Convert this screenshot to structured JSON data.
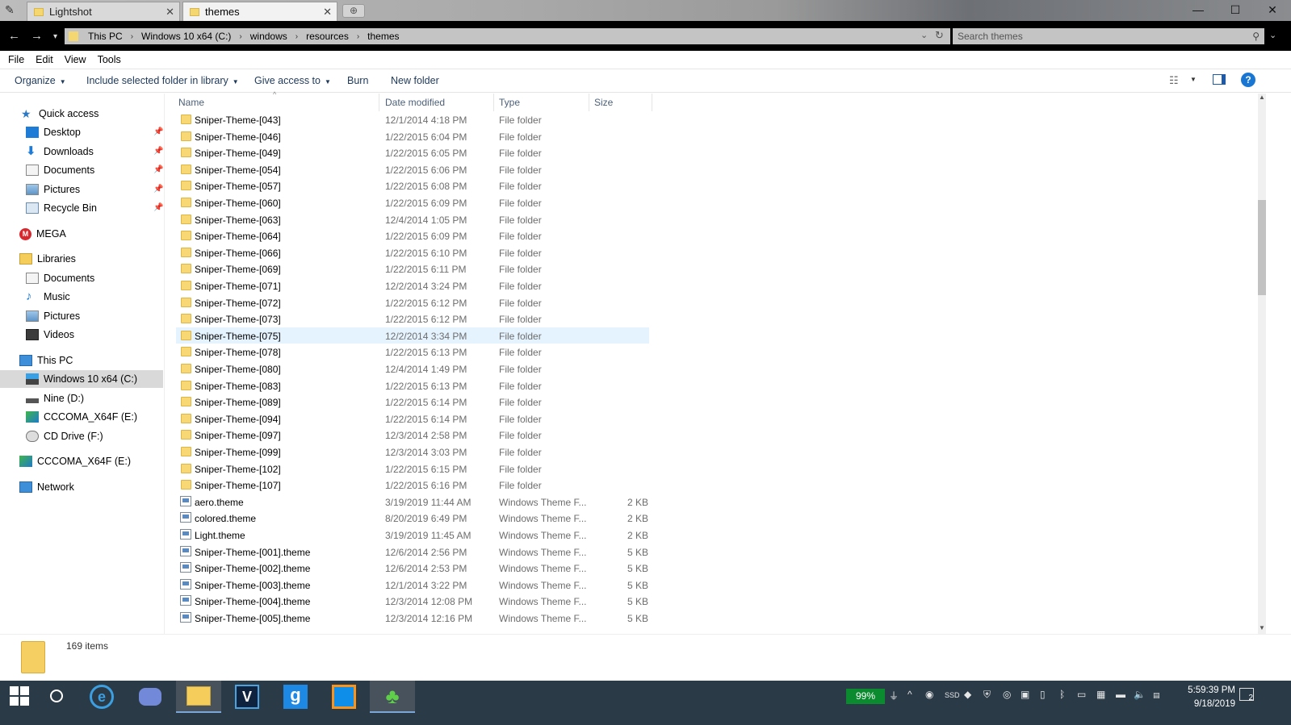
{
  "tabs": [
    {
      "label": "Lightshot"
    },
    {
      "label": "themes"
    }
  ],
  "window_controls": {
    "minimize": "—",
    "maximize": "☐",
    "close": "✕"
  },
  "address": {
    "segments": [
      "This PC",
      "Windows 10 x64 (C:)",
      "windows",
      "resources",
      "themes"
    ],
    "search_placeholder": "Search themes"
  },
  "menu": [
    "File",
    "Edit",
    "View",
    "Tools"
  ],
  "commands": {
    "organize": "Organize",
    "include": "Include selected folder in library",
    "give_access": "Give access to",
    "burn": "Burn",
    "new_folder": "New folder"
  },
  "nav": {
    "quick_access": "Quick access",
    "desktop": "Desktop",
    "downloads": "Downloads",
    "documents": "Documents",
    "pictures": "Pictures",
    "recycle_bin": "Recycle Bin",
    "mega": "MEGA",
    "libraries": "Libraries",
    "lib_documents": "Documents",
    "lib_music": "Music",
    "lib_pictures": "Pictures",
    "lib_videos": "Videos",
    "this_pc": "This PC",
    "drive_c": "Windows 10 x64 (C:)",
    "drive_d": "Nine (D:)",
    "drive_e": "CCCOMA_X64F (E:)",
    "drive_f": "CD Drive (F:)",
    "drive_e2": "CCCOMA_X64F (E:)",
    "network": "Network"
  },
  "columns": {
    "name": "Name",
    "date": "Date modified",
    "type": "Type",
    "size": "Size"
  },
  "files": [
    {
      "name": "Sniper-Theme-[043]",
      "date": "12/1/2014 4:18 PM",
      "type": "File folder",
      "size": "",
      "kind": "folder"
    },
    {
      "name": "Sniper-Theme-[046]",
      "date": "1/22/2015 6:04 PM",
      "type": "File folder",
      "size": "",
      "kind": "folder"
    },
    {
      "name": "Sniper-Theme-[049]",
      "date": "1/22/2015 6:05 PM",
      "type": "File folder",
      "size": "",
      "kind": "folder"
    },
    {
      "name": "Sniper-Theme-[054]",
      "date": "1/22/2015 6:06 PM",
      "type": "File folder",
      "size": "",
      "kind": "folder"
    },
    {
      "name": "Sniper-Theme-[057]",
      "date": "1/22/2015 6:08 PM",
      "type": "File folder",
      "size": "",
      "kind": "folder"
    },
    {
      "name": "Sniper-Theme-[060]",
      "date": "1/22/2015 6:09 PM",
      "type": "File folder",
      "size": "",
      "kind": "folder"
    },
    {
      "name": "Sniper-Theme-[063]",
      "date": "12/4/2014 1:05 PM",
      "type": "File folder",
      "size": "",
      "kind": "folder"
    },
    {
      "name": "Sniper-Theme-[064]",
      "date": "1/22/2015 6:09 PM",
      "type": "File folder",
      "size": "",
      "kind": "folder"
    },
    {
      "name": "Sniper-Theme-[066]",
      "date": "1/22/2015 6:10 PM",
      "type": "File folder",
      "size": "",
      "kind": "folder"
    },
    {
      "name": "Sniper-Theme-[069]",
      "date": "1/22/2015 6:11 PM",
      "type": "File folder",
      "size": "",
      "kind": "folder"
    },
    {
      "name": "Sniper-Theme-[071]",
      "date": "12/2/2014 3:24 PM",
      "type": "File folder",
      "size": "",
      "kind": "folder"
    },
    {
      "name": "Sniper-Theme-[072]",
      "date": "1/22/2015 6:12 PM",
      "type": "File folder",
      "size": "",
      "kind": "folder"
    },
    {
      "name": "Sniper-Theme-[073]",
      "date": "1/22/2015 6:12 PM",
      "type": "File folder",
      "size": "",
      "kind": "folder"
    },
    {
      "name": "Sniper-Theme-[075]",
      "date": "12/2/2014 3:34 PM",
      "type": "File folder",
      "size": "",
      "kind": "folder",
      "selected": true
    },
    {
      "name": "Sniper-Theme-[078]",
      "date": "1/22/2015 6:13 PM",
      "type": "File folder",
      "size": "",
      "kind": "folder"
    },
    {
      "name": "Sniper-Theme-[080]",
      "date": "12/4/2014 1:49 PM",
      "type": "File folder",
      "size": "",
      "kind": "folder"
    },
    {
      "name": "Sniper-Theme-[083]",
      "date": "1/22/2015 6:13 PM",
      "type": "File folder",
      "size": "",
      "kind": "folder"
    },
    {
      "name": "Sniper-Theme-[089]",
      "date": "1/22/2015 6:14 PM",
      "type": "File folder",
      "size": "",
      "kind": "folder"
    },
    {
      "name": "Sniper-Theme-[094]",
      "date": "1/22/2015 6:14 PM",
      "type": "File folder",
      "size": "",
      "kind": "folder"
    },
    {
      "name": "Sniper-Theme-[097]",
      "date": "12/3/2014 2:58 PM",
      "type": "File folder",
      "size": "",
      "kind": "folder"
    },
    {
      "name": "Sniper-Theme-[099]",
      "date": "12/3/2014 3:03 PM",
      "type": "File folder",
      "size": "",
      "kind": "folder"
    },
    {
      "name": "Sniper-Theme-[102]",
      "date": "1/22/2015 6:15 PM",
      "type": "File folder",
      "size": "",
      "kind": "folder"
    },
    {
      "name": "Sniper-Theme-[107]",
      "date": "1/22/2015 6:16 PM",
      "type": "File folder",
      "size": "",
      "kind": "folder"
    },
    {
      "name": "aero.theme",
      "date": "3/19/2019 11:44 AM",
      "type": "Windows Theme F...",
      "size": "2 KB",
      "kind": "theme"
    },
    {
      "name": "colored.theme",
      "date": "8/20/2019 6:49 PM",
      "type": "Windows Theme F...",
      "size": "2 KB",
      "kind": "theme"
    },
    {
      "name": "Light.theme",
      "date": "3/19/2019 11:45 AM",
      "type": "Windows Theme F...",
      "size": "2 KB",
      "kind": "theme"
    },
    {
      "name": "Sniper-Theme-[001].theme",
      "date": "12/6/2014 2:56 PM",
      "type": "Windows Theme F...",
      "size": "5 KB",
      "kind": "theme"
    },
    {
      "name": "Sniper-Theme-[002].theme",
      "date": "12/6/2014 2:53 PM",
      "type": "Windows Theme F...",
      "size": "5 KB",
      "kind": "theme"
    },
    {
      "name": "Sniper-Theme-[003].theme",
      "date": "12/1/2014 3:22 PM",
      "type": "Windows Theme F...",
      "size": "5 KB",
      "kind": "theme"
    },
    {
      "name": "Sniper-Theme-[004].theme",
      "date": "12/3/2014 12:08 PM",
      "type": "Windows Theme F...",
      "size": "5 KB",
      "kind": "theme"
    },
    {
      "name": "Sniper-Theme-[005].theme",
      "date": "12/3/2014 12:16 PM",
      "type": "Windows Theme F...",
      "size": "5 KB",
      "kind": "theme"
    }
  ],
  "status": {
    "item_count": "169 items"
  },
  "taskbar": {
    "battery": "99%",
    "time": "5:59:39 PM",
    "date": "9/18/2019",
    "notifications": "2",
    "apps": [
      "internet-explorer",
      "discord",
      "file-explorer",
      "vegas",
      "g-app",
      "teamviewer",
      "clover"
    ]
  },
  "colors": {
    "selection": "#e5f3ff",
    "accent": "#0078d7",
    "taskbar": "#2a3a47",
    "battery": "#0c8a2f"
  }
}
